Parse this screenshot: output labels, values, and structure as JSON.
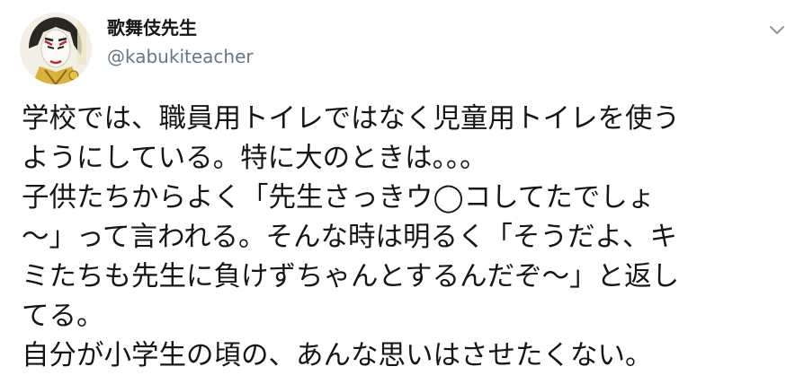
{
  "user": {
    "display_name": "歌舞伎先生",
    "handle": "@kabukiteacher",
    "avatar_icon": "kabuki-face-avatar"
  },
  "menu": {
    "icon": "chevron-down-icon"
  },
  "tweet": {
    "lines": [
      "学校では、職員用トイレではなく児童用トイレを使う",
      "ようにしている。特に大のときは。。。",
      "子供たちからよく「先生さっきウ◯コしてたでしょ",
      "〜」って言われる。そんな時は明るく「そうだよ、キ",
      "ミたちも先生に負けずちゃんとするんだぞ〜」と返し",
      "てる。",
      "自分が小学生の頃の、あんな思いはさせたくない。"
    ]
  },
  "colors": {
    "text": "#14171a",
    "secondary": "#657786",
    "chevron": "#8899a6"
  }
}
